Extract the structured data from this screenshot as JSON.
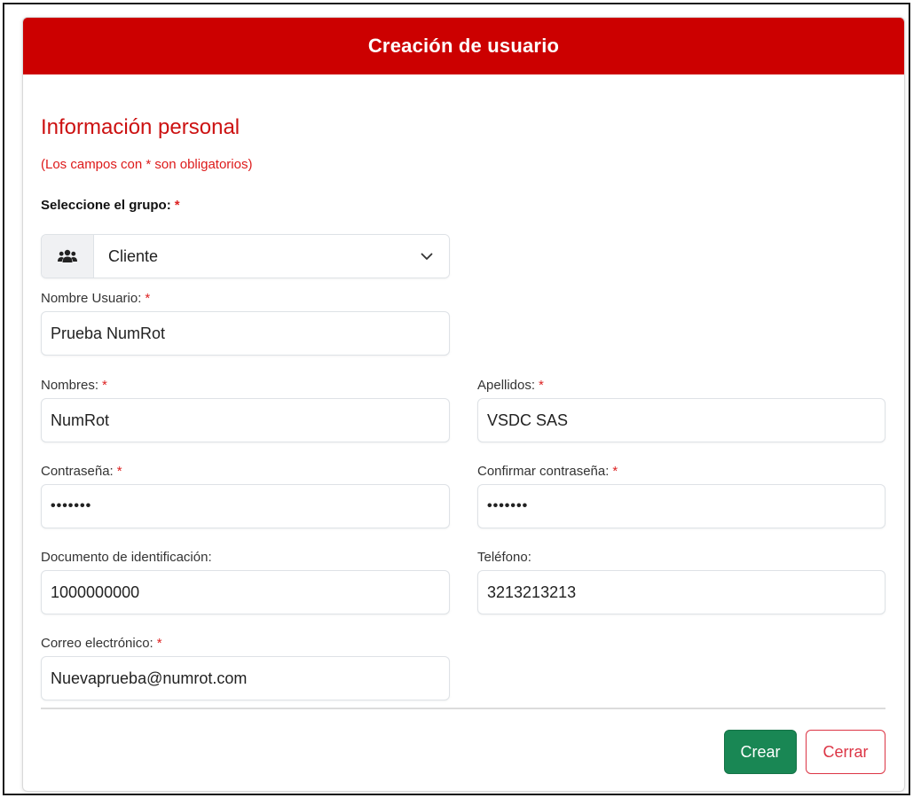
{
  "header": {
    "title": "Creación de usuario"
  },
  "section": {
    "title": "Información personal",
    "note": "(Los campos con * son obligatorios)"
  },
  "required_mark": "*",
  "group": {
    "label": "Seleccione el grupo:",
    "selected": "Cliente",
    "icon": "users-icon"
  },
  "fields": {
    "username": {
      "label": "Nombre Usuario:",
      "value": "Prueba NumRot"
    },
    "first_names": {
      "label": "Nombres:",
      "value": "NumRot"
    },
    "last_names": {
      "label": "Apellidos:",
      "value": "VSDC SAS"
    },
    "password": {
      "label": "Contraseña:",
      "value": "•••••••"
    },
    "confirm_password": {
      "label": "Confirmar contraseña:",
      "value": "•••••••"
    },
    "id_document": {
      "label": "Documento de identificación:",
      "value": "1000000000"
    },
    "phone": {
      "label": "Teléfono:",
      "value": "3213213213"
    },
    "email": {
      "label": "Correo electrónico:",
      "value": "Nuevaprueba@numrot.com"
    }
  },
  "buttons": {
    "create": "Crear",
    "close": "Cerrar"
  },
  "colors": {
    "header_bg": "#cc0000",
    "accent_red": "#cc1111",
    "create_btn": "#198754",
    "close_btn": "#dc3545"
  }
}
